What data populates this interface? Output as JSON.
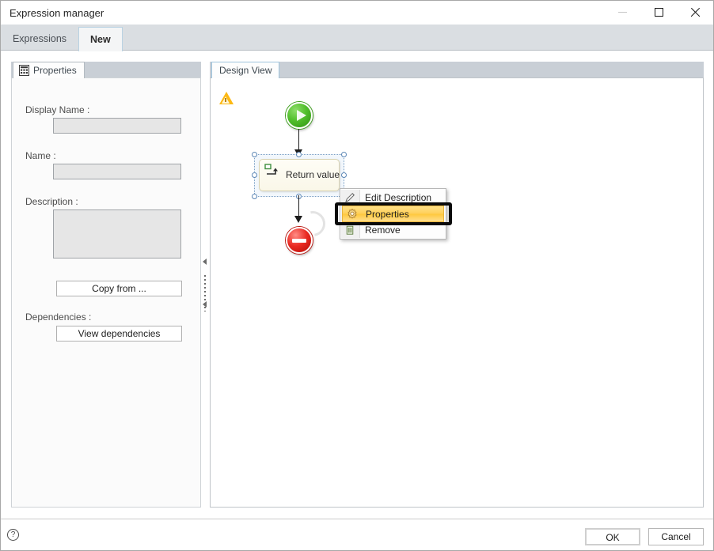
{
  "window": {
    "title": "Expression manager",
    "controls": {
      "minimize": "minimize-button",
      "maximize": "maximize-button",
      "close": "close-button"
    }
  },
  "tabs": [
    {
      "label": "Expressions",
      "active": false
    },
    {
      "label": "New",
      "active": true
    }
  ],
  "left_panel": {
    "tab_label": "Properties",
    "tab_icon": "properties-document-icon",
    "fields": [
      {
        "label": "Display Name :",
        "value": "",
        "placeholder": "",
        "type": "text"
      },
      {
        "label": "Name :",
        "value": "",
        "placeholder": "",
        "type": "text"
      },
      {
        "label": "Description :",
        "value": "",
        "placeholder": "",
        "type": "textarea"
      }
    ],
    "copy_from_button": "Copy from ...",
    "dependencies_label": "Dependencies :",
    "view_dependencies_button": "View dependencies"
  },
  "splitter": {
    "collapse_arrow_top": "collapse-left-arrow",
    "collapse_arrow_bottom": "collapse-left-arrow",
    "grip": "splitter-grip"
  },
  "design_panel": {
    "tab_label": "Design View",
    "nodes": [
      {
        "id": "start",
        "type": "start-node",
        "label": ""
      },
      {
        "id": "return-value",
        "type": "activity-node",
        "label": "Return value",
        "selected": true,
        "warning": true
      },
      {
        "id": "stop",
        "type": "stop-node",
        "label": ""
      }
    ],
    "context_menu": {
      "items": [
        {
          "label": "Edit Description",
          "icon": "pencil-icon",
          "selected": false
        },
        {
          "label": "Properties",
          "icon": "gear-icon",
          "selected": true
        },
        {
          "label": "Remove",
          "icon": "trash-icon",
          "selected": false
        }
      ],
      "highlight_target": "Properties"
    }
  },
  "footer": {
    "help_icon": "help-question-icon",
    "help_glyph": "?",
    "ok_button": "OK",
    "cancel_button": "Cancel"
  },
  "colors": {
    "accent_selected_menu": "#ffd05a",
    "start_node": "#52bf2c",
    "stop_node": "#ea2a22",
    "warning": "#fdb913",
    "tab_strip": "#dadee2",
    "highlight_box": "#0a0a0a"
  }
}
